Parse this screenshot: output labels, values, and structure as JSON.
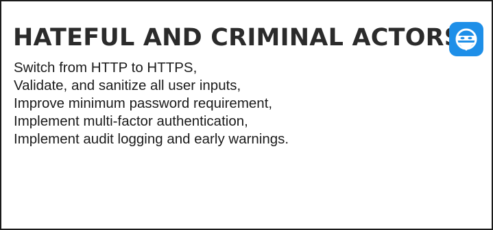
{
  "card": {
    "title": "HATEFUL AND CRIMINAL ACTORS",
    "icon": "masked-bandit-icon",
    "icon_color": "#1e8fe8",
    "lines": [
      "Switch from HTTP to HTTPS,",
      "Validate, and sanitize all user inputs,",
      "Improve minimum password requirement,",
      "Implement multi-factor authentication,",
      "Implement audit logging and early warnings."
    ]
  }
}
